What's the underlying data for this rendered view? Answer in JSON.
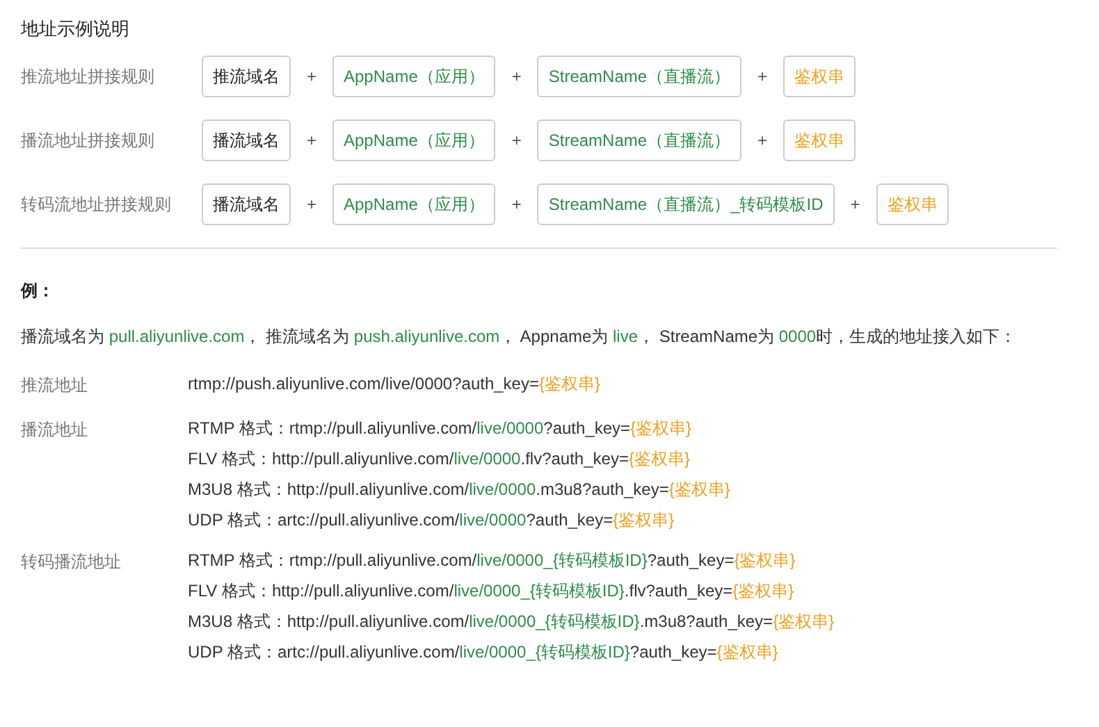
{
  "title": "地址示例说明",
  "rules": [
    {
      "label": "推流地址拼接规则",
      "parts": [
        {
          "text": "推流域名",
          "kind": "domain"
        },
        {
          "text": "AppName（应用）",
          "kind": "app"
        },
        {
          "text": "StreamName（直播流）",
          "kind": "stream"
        },
        {
          "text": "鉴权串",
          "kind": "key"
        }
      ]
    },
    {
      "label": "播流地址拼接规则",
      "parts": [
        {
          "text": "播流域名",
          "kind": "domain"
        },
        {
          "text": "AppName（应用）",
          "kind": "app"
        },
        {
          "text": "StreamName（直播流）",
          "kind": "stream"
        },
        {
          "text": "鉴权串",
          "kind": "key"
        }
      ]
    },
    {
      "label": "转码流地址拼接规则",
      "parts": [
        {
          "text": "播流域名",
          "kind": "domain"
        },
        {
          "text": "AppName（应用）",
          "kind": "app"
        },
        {
          "text": "StreamName（直播流）_转码模板ID",
          "kind": "stream"
        },
        {
          "text": "鉴权串",
          "kind": "key"
        }
      ]
    }
  ],
  "plus": "+",
  "example_heading": "例：",
  "intro": [
    {
      "text": "播流域名为 ",
      "kind": "plain"
    },
    {
      "text": "pull.aliyunlive.com",
      "kind": "var"
    },
    {
      "text": "， 推流域名为 ",
      "kind": "plain"
    },
    {
      "text": "push.aliyunlive.com",
      "kind": "var"
    },
    {
      "text": "， Appname为 ",
      "kind": "plain"
    },
    {
      "text": "live",
      "kind": "var"
    },
    {
      "text": "， StreamName为 ",
      "kind": "plain"
    },
    {
      "text": "0000",
      "kind": "var"
    },
    {
      "text": "时，生成的地址接入如下：",
      "kind": "plain"
    }
  ],
  "addresses": [
    {
      "label": "推流地址",
      "lines": [
        [
          {
            "text": "rtmp://push.aliyunlive.com/live/0000?auth_key=",
            "kind": "plain"
          },
          {
            "text": "{鉴权串}",
            "kind": "key"
          }
        ]
      ]
    },
    {
      "label": "播流地址",
      "lines": [
        [
          {
            "text": "RTMP 格式：rtmp://pull.aliyunlive.com/",
            "kind": "plain"
          },
          {
            "text": "live/0000",
            "kind": "var"
          },
          {
            "text": "?auth_key=",
            "kind": "plain"
          },
          {
            "text": "{鉴权串}",
            "kind": "key"
          }
        ],
        [
          {
            "text": "FLV 格式：http://pull.aliyunlive.com/",
            "kind": "plain"
          },
          {
            "text": "live/0000",
            "kind": "var"
          },
          {
            "text": ".flv?auth_key=",
            "kind": "plain"
          },
          {
            "text": "{鉴权串}",
            "kind": "key"
          }
        ],
        [
          {
            "text": "M3U8 格式：http://pull.aliyunlive.com/",
            "kind": "plain"
          },
          {
            "text": "live/0000",
            "kind": "var"
          },
          {
            "text": ".m3u8?auth_key=",
            "kind": "plain"
          },
          {
            "text": "{鉴权串}",
            "kind": "key"
          }
        ],
        [
          {
            "text": "UDP 格式：artc://pull.aliyunlive.com/",
            "kind": "plain"
          },
          {
            "text": "live/0000",
            "kind": "var"
          },
          {
            "text": "?auth_key=",
            "kind": "plain"
          },
          {
            "text": "{鉴权串}",
            "kind": "key"
          }
        ]
      ]
    },
    {
      "label": "转码播流地址",
      "lines": [
        [
          {
            "text": "RTMP 格式：rtmp://pull.aliyunlive.com/",
            "kind": "plain"
          },
          {
            "text": "live/0000_{转码模板ID}",
            "kind": "var"
          },
          {
            "text": "?auth_key=",
            "kind": "plain"
          },
          {
            "text": "{鉴权串}",
            "kind": "key"
          }
        ],
        [
          {
            "text": "FLV 格式：http://pull.aliyunlive.com/",
            "kind": "plain"
          },
          {
            "text": "live/0000_{转码模板ID}",
            "kind": "var"
          },
          {
            "text": ".flv?auth_key=",
            "kind": "plain"
          },
          {
            "text": "{鉴权串}",
            "kind": "key"
          }
        ],
        [
          {
            "text": "M3U8 格式：http://pull.aliyunlive.com/",
            "kind": "plain"
          },
          {
            "text": "live/0000_{转码模板ID}",
            "kind": "var"
          },
          {
            "text": ".m3u8?auth_key=",
            "kind": "plain"
          },
          {
            "text": "{鉴权串}",
            "kind": "key"
          }
        ],
        [
          {
            "text": "UDP 格式：artc://pull.aliyunlive.com/",
            "kind": "plain"
          },
          {
            "text": "live/0000_{转码模板ID}",
            "kind": "var"
          },
          {
            "text": "?auth_key=",
            "kind": "plain"
          },
          {
            "text": "{鉴权串}",
            "kind": "key"
          }
        ]
      ]
    }
  ]
}
